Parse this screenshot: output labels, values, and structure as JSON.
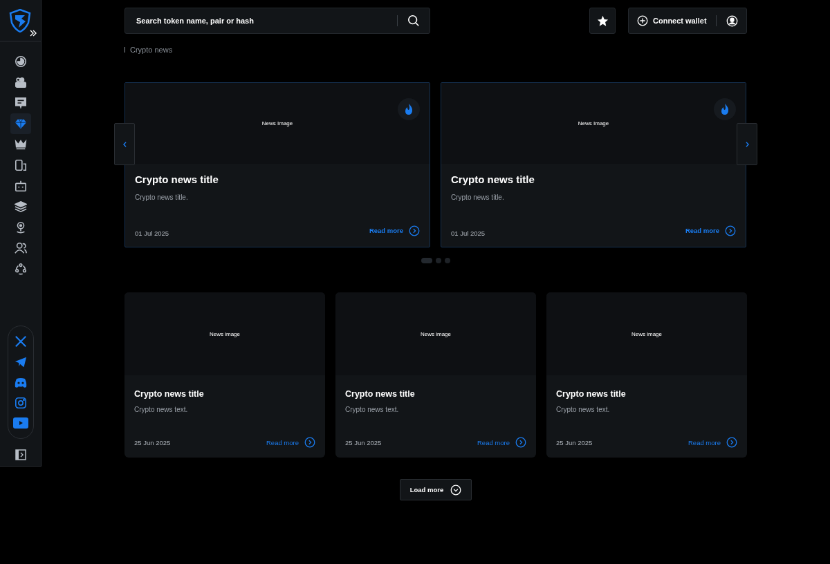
{
  "sidebar": {
    "nav_items": [
      {
        "selected": false
      },
      {
        "selected": false
      },
      {
        "selected": false
      },
      {
        "selected": true
      },
      {
        "selected": false
      },
      {
        "selected": false
      },
      {
        "selected": false
      },
      {
        "selected": false
      },
      {
        "selected": false
      },
      {
        "selected": false
      },
      {
        "selected": false
      }
    ]
  },
  "search": {
    "placeholder": "Search token name, pair or hash"
  },
  "header": {
    "connect_label": "Connect wallet"
  },
  "breadcrumb": "Crypto news",
  "featured": [
    {
      "image_label": "News Image",
      "hot": true,
      "title": "Crypto news title",
      "text": "Crypto news title.",
      "date": "01 Jul 2025",
      "link": "Read more"
    },
    {
      "image_label": "News Image",
      "hot": true,
      "title": "Crypto news title",
      "text": "Crypto news title.",
      "date": "01 Jul 2025",
      "link": "Read more"
    }
  ],
  "carousel_dots": [
    {
      "selected": true
    },
    {
      "selected": false
    },
    {
      "selected": false
    }
  ],
  "news": [
    {
      "image_label": "News image",
      "title": "Crypto news title",
      "text": "Crypto news text.",
      "date": "25 Jun 2025",
      "link": "Read more"
    },
    {
      "image_label": "News image",
      "title": "Crypto news title",
      "text": "Crypto news text.",
      "date": "25 Jun 2025",
      "link": "Read more"
    },
    {
      "image_label": "News image",
      "title": "Crypto news title",
      "text": "Crypto news text.",
      "date": "25 Jun 2025",
      "link": "Read more"
    }
  ],
  "load_more": "Load more"
}
